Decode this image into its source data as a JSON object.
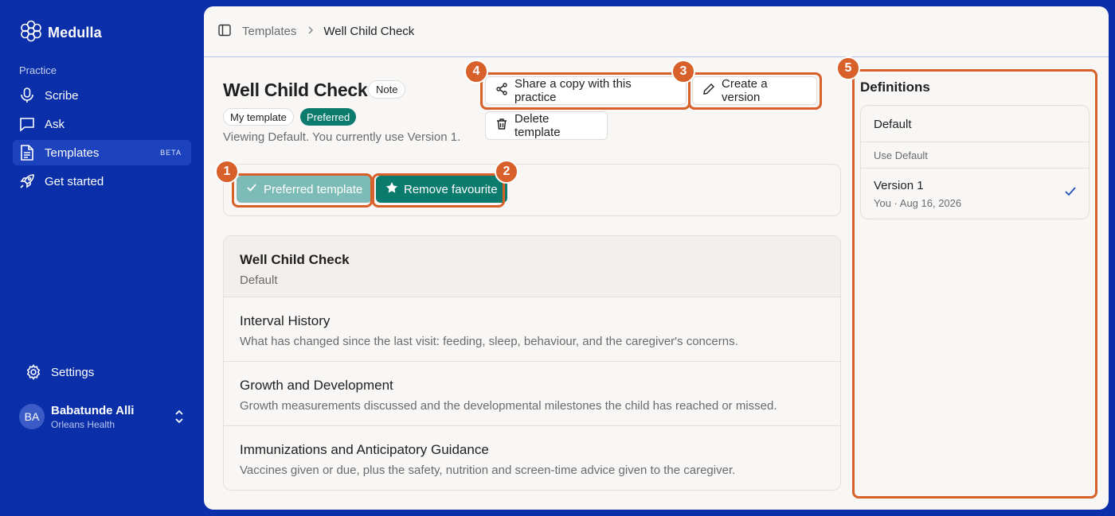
{
  "app": {
    "name": "Medulla"
  },
  "sidebar": {
    "section_label": "Practice",
    "items": [
      {
        "label": "Scribe",
        "icon": "microphone-icon"
      },
      {
        "label": "Ask",
        "icon": "chat-icon"
      },
      {
        "label": "Templates",
        "icon": "document-icon",
        "badge": "BETA",
        "active": true
      },
      {
        "label": "Get started",
        "icon": "rocket-icon"
      }
    ],
    "settings_label": "Settings",
    "user": {
      "initials": "BA",
      "name": "Babatunde Alli",
      "org": "Orleans Health"
    }
  },
  "breadcrumb": {
    "parent": "Templates",
    "current": "Well Child Check"
  },
  "template": {
    "title": "Well Child Check",
    "type_badge": "Note",
    "tags": [
      "My template",
      "Preferred"
    ],
    "viewing_text": "Viewing Default. You currently use Version 1."
  },
  "actions": {
    "share": "Share a copy with this practice",
    "create_version": "Create a version",
    "delete": "Delete template",
    "preferred": "Preferred template",
    "remove_favourite": "Remove favourite"
  },
  "sections": [
    {
      "title": "Well Child Check",
      "subtitle": "Default"
    },
    {
      "title": "Interval History",
      "subtitle": "What has changed since the last visit: feeding, sleep, behaviour, and the caregiver's concerns."
    },
    {
      "title": "Growth and Development",
      "subtitle": "Growth measurements discussed and the developmental milestones the child has reached or missed."
    },
    {
      "title": "Immunizations and Anticipatory Guidance",
      "subtitle": "Vaccines given or due, plus the safety, nutrition and screen-time advice given to the caregiver."
    }
  ],
  "definitions": {
    "title": "Definitions",
    "default_label": "Default",
    "use_default": "Use Default",
    "version": {
      "title": "Version 1",
      "meta": "You · Aug 16, 2026",
      "selected": true
    }
  },
  "annotations": [
    "1",
    "2",
    "3",
    "4",
    "5"
  ],
  "colors": {
    "sidebar": "#0a2fa8",
    "accent": "#0a7b6d",
    "highlight": "#d8602a"
  }
}
